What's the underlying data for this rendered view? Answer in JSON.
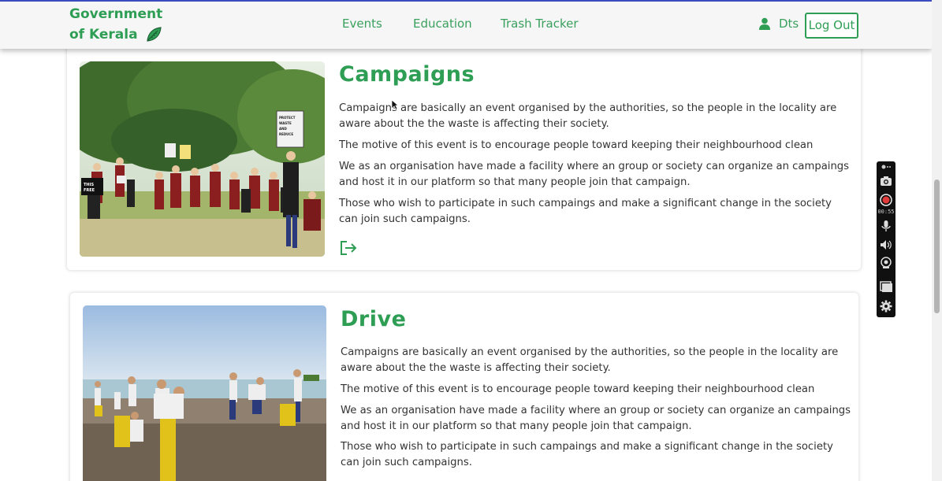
{
  "brand": {
    "line1": "Government",
    "line2": "of Kerala",
    "logo_icon": "leaf-icon"
  },
  "nav": {
    "links": [
      {
        "label": "Events"
      },
      {
        "label": "Education"
      },
      {
        "label": "Trash Tracker"
      }
    ],
    "user": {
      "icon": "user-icon",
      "name": "Dts"
    },
    "logout_label": "Log Out"
  },
  "cards": [
    {
      "title": "Campaigns",
      "paragraphs": [
        "Campaigns are basically an event organised by the authorities, so the people in the locality are aware about the the waste is affecting their society.",
        "The motive of this event is to encourage people toward keeping their neighbourhood clean",
        "We as an organisation have made a facility where an group or society can organize an campaings and host it in our platform so that many people join that campaign.",
        "Those who wish to participate in such campaings and make a significant change in the society can join such campaigns."
      ],
      "action_icon": "sign-out-arrow-icon",
      "photo_signs": [
        "PROTECT WASTE AND REDUCE",
        "THIS FREE"
      ]
    },
    {
      "title": "Drive",
      "paragraphs": [
        "Campaigns are basically an event organised by the authorities, so the people in the locality are aware about the the waste is affecting their society.",
        "The motive of this event is to encourage people toward keeping their neighbourhood clean",
        "We as an organisation have made a facility where an group or society can organize an campaings and host it in our platform so that many people join that campaign.",
        "Those who wish to participate in such campaings and make a significant change in the society can join such campaigns."
      ]
    }
  ],
  "recorder": {
    "timer": "00:55",
    "icons": [
      "record-menu-icon",
      "camera-icon",
      "record-icon",
      "microphone-icon",
      "speaker-icon",
      "webcam-icon",
      "window-icon",
      "gear-icon"
    ]
  },
  "colors": {
    "brand_green": "#2e9e54",
    "nav_bg": "#f6f6f6",
    "nav_top_border": "#3b4cc0"
  }
}
